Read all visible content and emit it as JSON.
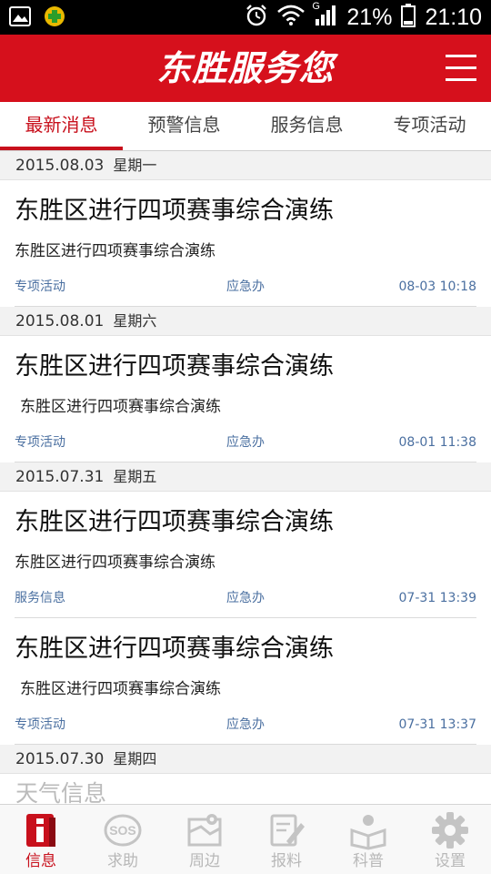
{
  "status_bar": {
    "battery": "21%",
    "time": "21:10",
    "network_type": "G",
    "icons": [
      "image-icon",
      "app-plus-icon",
      "alarm-icon",
      "wifi-icon",
      "signal-icon",
      "battery-icon"
    ]
  },
  "header": {
    "title": "东胜服务您",
    "menu_icon": "hamburger-menu-icon",
    "background_color": "#d6101c"
  },
  "tabs": [
    {
      "label": "最新消息",
      "active": true
    },
    {
      "label": "预警信息",
      "active": false
    },
    {
      "label": "服务信息",
      "active": false
    },
    {
      "label": "专项活动",
      "active": false
    }
  ],
  "feed": {
    "groups": [
      {
        "date": "2015.08.03",
        "weekday": "星期一",
        "items": [
          {
            "title": "东胜区进行四项赛事综合演练",
            "summary": "东胜区进行四项赛事综合演练",
            "category": "专项活动",
            "source": "应急办",
            "time": "08-03 10:18"
          }
        ]
      },
      {
        "date": "2015.08.01",
        "weekday": "星期六",
        "items": [
          {
            "title": "东胜区进行四项赛事综合演练",
            "summary": "东胜区进行四项赛事综合演练",
            "category": "专项活动",
            "source": "应急办",
            "time": "08-01 11:38"
          }
        ]
      },
      {
        "date": "2015.07.31",
        "weekday": "星期五",
        "items": [
          {
            "title": "东胜区进行四项赛事综合演练",
            "summary": "东胜区进行四项赛事综合演练",
            "category": "服务信息",
            "source": "应急办",
            "time": "07-31 13:39"
          },
          {
            "title": "东胜区进行四项赛事综合演练",
            "summary": "东胜区进行四项赛事综合演练",
            "category": "专项活动",
            "source": "应急办",
            "time": "07-31 13:37"
          }
        ]
      },
      {
        "date": "2015.07.30",
        "weekday": "星期四",
        "partial_title": "天气信息"
      }
    ]
  },
  "bottom_nav": [
    {
      "label": "信息",
      "icon": "info-icon",
      "active": true
    },
    {
      "label": "求助",
      "icon": "sos-icon",
      "active": false
    },
    {
      "label": "周边",
      "icon": "map-icon",
      "active": false
    },
    {
      "label": "报料",
      "icon": "report-edit-icon",
      "active": false
    },
    {
      "label": "科普",
      "icon": "reading-icon",
      "active": false
    },
    {
      "label": "设置",
      "icon": "gear-icon",
      "active": false
    }
  ],
  "colors": {
    "accent": "#c8101c",
    "meta_text": "#4a6fa0",
    "inactive_nav": "#b8b8b8"
  }
}
